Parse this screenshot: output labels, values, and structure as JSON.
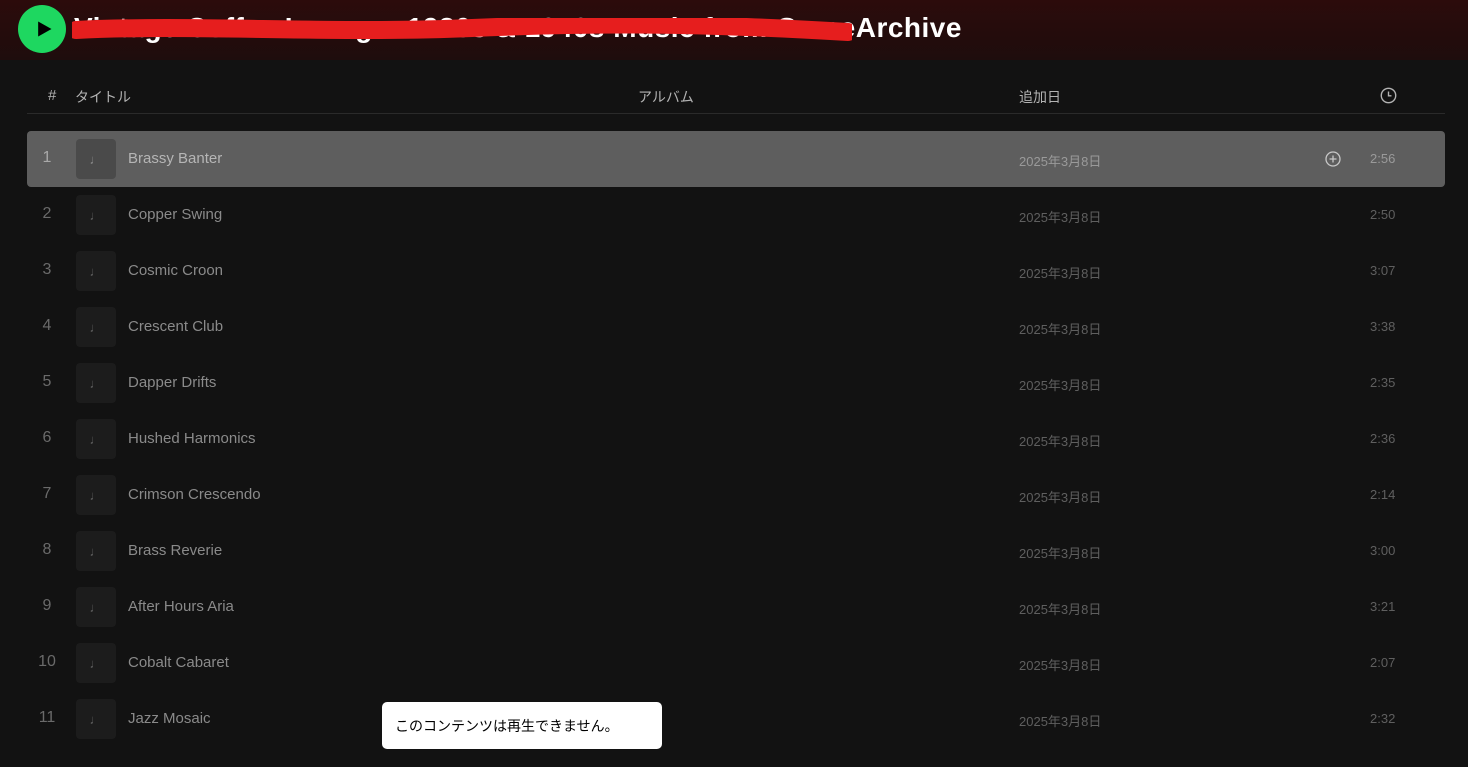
{
  "header": {
    "playlist_title": "Vintage Coffee Lounge: 1930s & 1940s Music from GameArchive",
    "play_icon": "play-icon",
    "redaction_color": "#e61e1e",
    "accent": "#1ed760"
  },
  "columns": {
    "number": "#",
    "title": "タイトル",
    "album": "アルバム",
    "date_added": "追加日",
    "duration_icon": "clock-icon"
  },
  "tracks": [
    {
      "number": "1",
      "title": "Brassy Banter",
      "added": "2025年3月8日",
      "duration": "2:56"
    },
    {
      "number": "2",
      "title": "Copper Swing",
      "added": "2025年3月8日",
      "duration": "2:50"
    },
    {
      "number": "3",
      "title": "Cosmic Croon",
      "added": "2025年3月8日",
      "duration": "3:07"
    },
    {
      "number": "4",
      "title": "Crescent Club",
      "added": "2025年3月8日",
      "duration": "3:38"
    },
    {
      "number": "5",
      "title": "Dapper Drifts",
      "added": "2025年3月8日",
      "duration": "2:35"
    },
    {
      "number": "6",
      "title": "Hushed Harmonics",
      "added": "2025年3月8日",
      "duration": "2:36"
    },
    {
      "number": "7",
      "title": "Crimson Crescendo",
      "added": "2025年3月8日",
      "duration": "2:14"
    },
    {
      "number": "8",
      "title": "Brass Reverie",
      "added": "2025年3月8日",
      "duration": "3:00"
    },
    {
      "number": "9",
      "title": "After Hours Aria",
      "added": "2025年3月8日",
      "duration": "3:21"
    },
    {
      "number": "10",
      "title": "Cobalt Cabaret",
      "added": "2025年3月8日",
      "duration": "2:07"
    },
    {
      "number": "11",
      "title": "Jazz Mosaic",
      "added": "2025年3月8日",
      "duration": "2:32"
    }
  ],
  "row_icons": {
    "thumb": "music-note-icon",
    "add": "add-circle-icon"
  },
  "toast": {
    "message": "このコンテンツは再生できません。"
  }
}
